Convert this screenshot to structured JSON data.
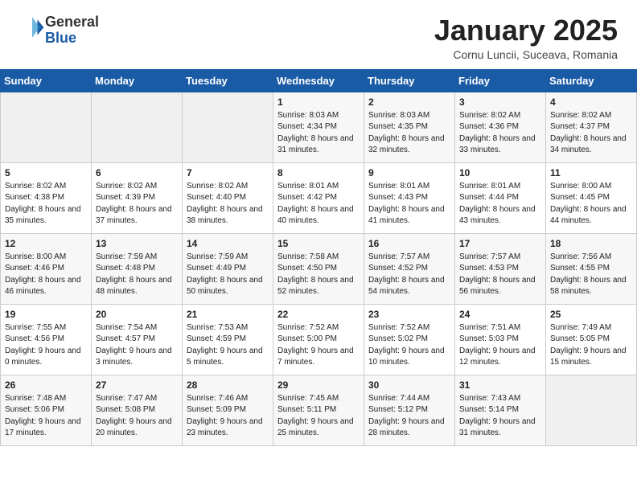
{
  "header": {
    "logo_general": "General",
    "logo_blue": "Blue",
    "month_title": "January 2025",
    "location": "Cornu Luncii, Suceava, Romania"
  },
  "weekdays": [
    "Sunday",
    "Monday",
    "Tuesday",
    "Wednesday",
    "Thursday",
    "Friday",
    "Saturday"
  ],
  "weeks": [
    [
      {
        "day": "",
        "info": ""
      },
      {
        "day": "",
        "info": ""
      },
      {
        "day": "",
        "info": ""
      },
      {
        "day": "1",
        "info": "Sunrise: 8:03 AM\nSunset: 4:34 PM\nDaylight: 8 hours and 31 minutes."
      },
      {
        "day": "2",
        "info": "Sunrise: 8:03 AM\nSunset: 4:35 PM\nDaylight: 8 hours and 32 minutes."
      },
      {
        "day": "3",
        "info": "Sunrise: 8:02 AM\nSunset: 4:36 PM\nDaylight: 8 hours and 33 minutes."
      },
      {
        "day": "4",
        "info": "Sunrise: 8:02 AM\nSunset: 4:37 PM\nDaylight: 8 hours and 34 minutes."
      }
    ],
    [
      {
        "day": "5",
        "info": "Sunrise: 8:02 AM\nSunset: 4:38 PM\nDaylight: 8 hours and 35 minutes."
      },
      {
        "day": "6",
        "info": "Sunrise: 8:02 AM\nSunset: 4:39 PM\nDaylight: 8 hours and 37 minutes."
      },
      {
        "day": "7",
        "info": "Sunrise: 8:02 AM\nSunset: 4:40 PM\nDaylight: 8 hours and 38 minutes."
      },
      {
        "day": "8",
        "info": "Sunrise: 8:01 AM\nSunset: 4:42 PM\nDaylight: 8 hours and 40 minutes."
      },
      {
        "day": "9",
        "info": "Sunrise: 8:01 AM\nSunset: 4:43 PM\nDaylight: 8 hours and 41 minutes."
      },
      {
        "day": "10",
        "info": "Sunrise: 8:01 AM\nSunset: 4:44 PM\nDaylight: 8 hours and 43 minutes."
      },
      {
        "day": "11",
        "info": "Sunrise: 8:00 AM\nSunset: 4:45 PM\nDaylight: 8 hours and 44 minutes."
      }
    ],
    [
      {
        "day": "12",
        "info": "Sunrise: 8:00 AM\nSunset: 4:46 PM\nDaylight: 8 hours and 46 minutes."
      },
      {
        "day": "13",
        "info": "Sunrise: 7:59 AM\nSunset: 4:48 PM\nDaylight: 8 hours and 48 minutes."
      },
      {
        "day": "14",
        "info": "Sunrise: 7:59 AM\nSunset: 4:49 PM\nDaylight: 8 hours and 50 minutes."
      },
      {
        "day": "15",
        "info": "Sunrise: 7:58 AM\nSunset: 4:50 PM\nDaylight: 8 hours and 52 minutes."
      },
      {
        "day": "16",
        "info": "Sunrise: 7:57 AM\nSunset: 4:52 PM\nDaylight: 8 hours and 54 minutes."
      },
      {
        "day": "17",
        "info": "Sunrise: 7:57 AM\nSunset: 4:53 PM\nDaylight: 8 hours and 56 minutes."
      },
      {
        "day": "18",
        "info": "Sunrise: 7:56 AM\nSunset: 4:55 PM\nDaylight: 8 hours and 58 minutes."
      }
    ],
    [
      {
        "day": "19",
        "info": "Sunrise: 7:55 AM\nSunset: 4:56 PM\nDaylight: 9 hours and 0 minutes."
      },
      {
        "day": "20",
        "info": "Sunrise: 7:54 AM\nSunset: 4:57 PM\nDaylight: 9 hours and 3 minutes."
      },
      {
        "day": "21",
        "info": "Sunrise: 7:53 AM\nSunset: 4:59 PM\nDaylight: 9 hours and 5 minutes."
      },
      {
        "day": "22",
        "info": "Sunrise: 7:52 AM\nSunset: 5:00 PM\nDaylight: 9 hours and 7 minutes."
      },
      {
        "day": "23",
        "info": "Sunrise: 7:52 AM\nSunset: 5:02 PM\nDaylight: 9 hours and 10 minutes."
      },
      {
        "day": "24",
        "info": "Sunrise: 7:51 AM\nSunset: 5:03 PM\nDaylight: 9 hours and 12 minutes."
      },
      {
        "day": "25",
        "info": "Sunrise: 7:49 AM\nSunset: 5:05 PM\nDaylight: 9 hours and 15 minutes."
      }
    ],
    [
      {
        "day": "26",
        "info": "Sunrise: 7:48 AM\nSunset: 5:06 PM\nDaylight: 9 hours and 17 minutes."
      },
      {
        "day": "27",
        "info": "Sunrise: 7:47 AM\nSunset: 5:08 PM\nDaylight: 9 hours and 20 minutes."
      },
      {
        "day": "28",
        "info": "Sunrise: 7:46 AM\nSunset: 5:09 PM\nDaylight: 9 hours and 23 minutes."
      },
      {
        "day": "29",
        "info": "Sunrise: 7:45 AM\nSunset: 5:11 PM\nDaylight: 9 hours and 25 minutes."
      },
      {
        "day": "30",
        "info": "Sunrise: 7:44 AM\nSunset: 5:12 PM\nDaylight: 9 hours and 28 minutes."
      },
      {
        "day": "31",
        "info": "Sunrise: 7:43 AM\nSunset: 5:14 PM\nDaylight: 9 hours and 31 minutes."
      },
      {
        "day": "",
        "info": ""
      }
    ]
  ]
}
